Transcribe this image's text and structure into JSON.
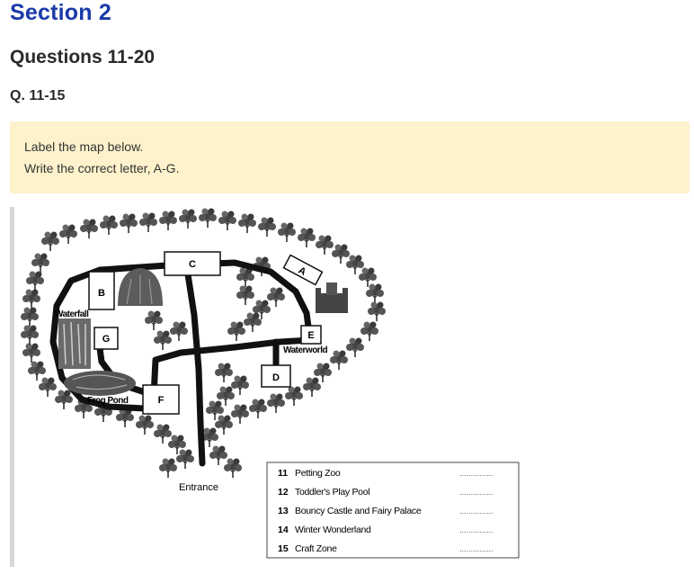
{
  "header": {
    "section_title": "Section 2",
    "questions_title": "Questions 11-20",
    "question_range": "Q. 11-15"
  },
  "instructions": {
    "line1": "Label the map below.",
    "line2": "Write the correct letter, A-G."
  },
  "map": {
    "box_labels": {
      "a": "A",
      "b": "B",
      "c": "C",
      "d": "D",
      "e": "E",
      "f": "F",
      "g": "G"
    },
    "place_labels": {
      "waterfall": "Waterfall",
      "waterworld": "Waterworld",
      "frog_pond": "Frog Pond",
      "entrance": "Entrance"
    },
    "answer_items": [
      {
        "number": "11",
        "text": "Petting Zoo",
        "blank": "..............."
      },
      {
        "number": "12",
        "text": "Toddler's Play Pool",
        "blank": "..............."
      },
      {
        "number": "13",
        "text": "Bouncy Castle and Fairy Palace",
        "blank": "..............."
      },
      {
        "number": "14",
        "text": "Winter Wonderland",
        "blank": "..............."
      },
      {
        "number": "15",
        "text": "Craft Zone",
        "blank": "..............."
      }
    ]
  }
}
